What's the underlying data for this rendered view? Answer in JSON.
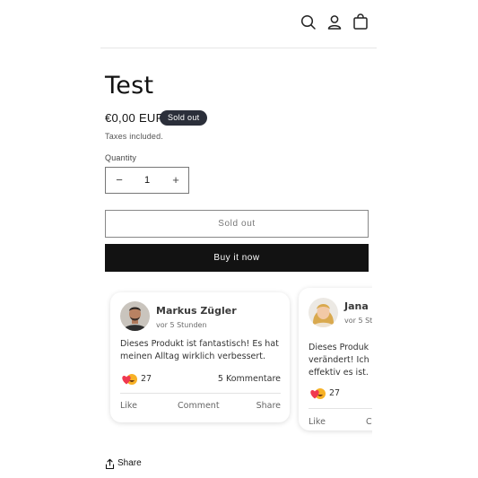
{
  "header": {
    "icons": [
      "search-icon",
      "account-icon",
      "cart-icon"
    ]
  },
  "product": {
    "title": "Test",
    "price": "€0,00 EUR",
    "badge": "Sold out",
    "taxes": "Taxes included.",
    "quantity_label": "Quantity",
    "quantity_value": "1",
    "decrease": "−",
    "increase": "+",
    "sold_out_button": "Sold out",
    "buy_button": "Buy it now",
    "share_label": "Share"
  },
  "reviews": [
    {
      "author": "Markus Zügler",
      "time": "vor 5 Stunden",
      "text": "Dieses Produkt ist fantastisch! Es hat meinen Alltag wirklich verbessert.",
      "reactions": "27",
      "comments": "5 Kommentare",
      "actions": [
        "Like",
        "Comment",
        "Share"
      ]
    },
    {
      "author": "Jana S",
      "time": "vor 5 St",
      "text_lines": [
        "Dieses Produk",
        "verändert! Ich k",
        "effektiv es ist."
      ],
      "reactions": "27",
      "actions": [
        "Like",
        "C"
      ]
    }
  ],
  "colors": {
    "badge_bg": "#2b2f3a",
    "buy_button_bg": "#121212",
    "text": "#121212"
  }
}
